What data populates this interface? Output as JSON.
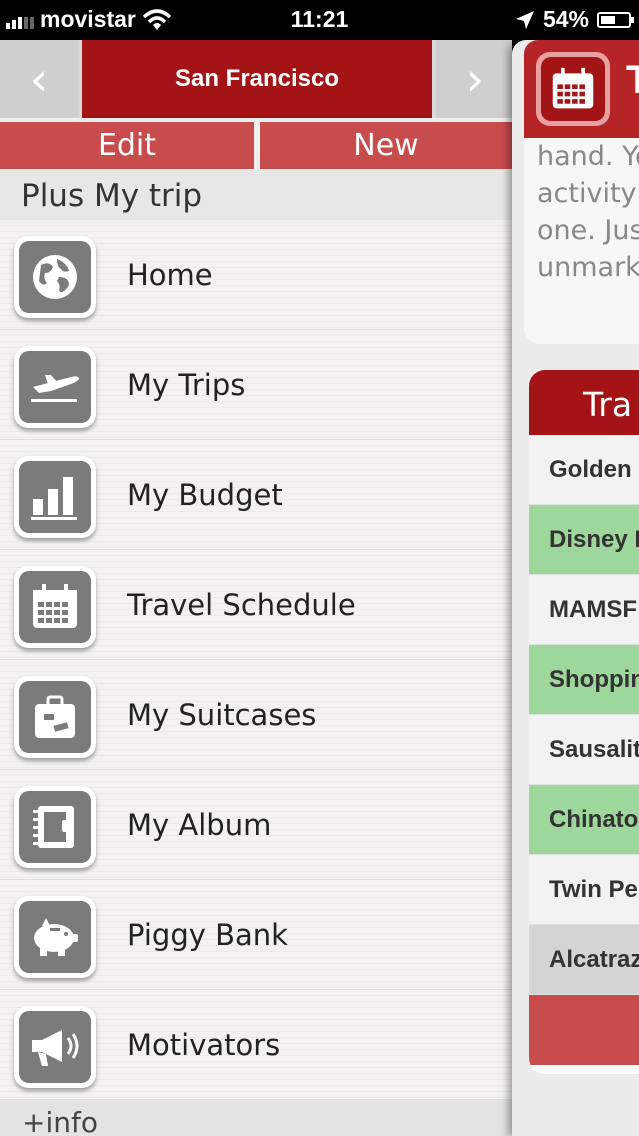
{
  "status_bar": {
    "carrier": "movistar",
    "time": "11:21",
    "battery": "54%",
    "battery_level": 0.54
  },
  "menu": {
    "city": "San Francisco",
    "edit_label": "Edit",
    "new_label": "New",
    "section_title": "Plus My trip",
    "items": [
      {
        "label": "Home",
        "icon": "globe-icon"
      },
      {
        "label": "My Trips",
        "icon": "airplane-icon"
      },
      {
        "label": "My Budget",
        "icon": "bar-chart-icon"
      },
      {
        "label": "Travel Schedule",
        "icon": "calendar-icon"
      },
      {
        "label": "My Suitcases",
        "icon": "suitcase-icon"
      },
      {
        "label": "My Album",
        "icon": "album-icon"
      },
      {
        "label": "Piggy Bank",
        "icon": "piggy-bank-icon"
      },
      {
        "label": "Motivators",
        "icon": "megaphone-icon"
      }
    ],
    "footer": "+info"
  },
  "panel": {
    "title": "T",
    "text_lines": [
      "hand. Yo",
      "activity",
      "one. Jus",
      "unmark"
    ],
    "table_title": "Tra",
    "rows": [
      {
        "label": "Golden",
        "state": "white"
      },
      {
        "label": "Disney I",
        "state": "green"
      },
      {
        "label": "MAMSF",
        "state": "white"
      },
      {
        "label": "Shoppin",
        "state": "green"
      },
      {
        "label": "Sausalit",
        "state": "white"
      },
      {
        "label": "Chinato",
        "state": "green"
      },
      {
        "label": "Twin Pe",
        "state": "white"
      },
      {
        "label": "Alcatraz",
        "state": "gray"
      }
    ]
  }
}
